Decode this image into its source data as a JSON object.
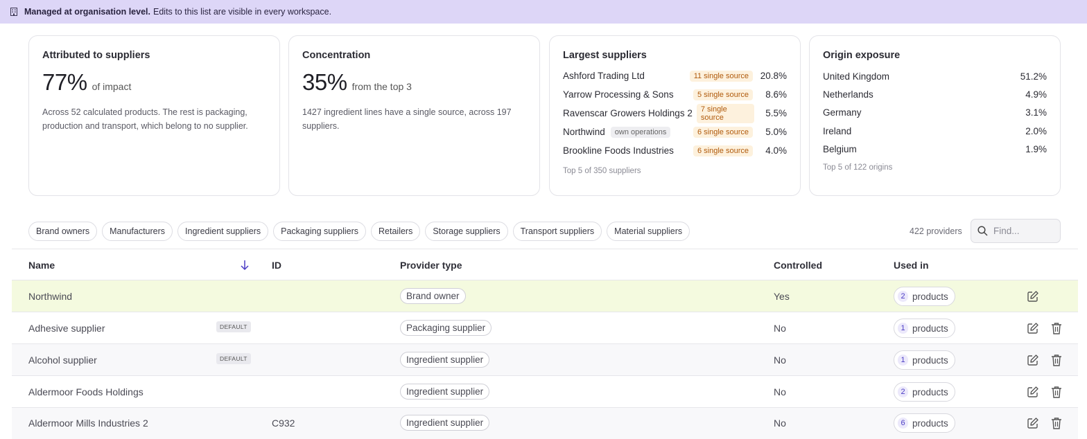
{
  "banner": {
    "bold": "Managed at organisation level.",
    "text": "Edits to this list are visible in every workspace."
  },
  "cards": {
    "attributed": {
      "title": "Attributed to suppliers",
      "value": "77%",
      "suffix": "of impact",
      "desc": "Across 52 calculated products. The rest is packaging, production and transport, which belong to no supplier."
    },
    "concentration": {
      "title": "Concentration",
      "value": "35%",
      "suffix": "from the top 3",
      "desc": "1427 ingredient lines have a single source, across 197 suppliers."
    },
    "largest": {
      "title": "Largest suppliers",
      "rows": [
        {
          "name": "Ashford Trading Ltd",
          "own": "",
          "single": "11 single source",
          "pct": "20.8%"
        },
        {
          "name": "Yarrow Processing & Sons",
          "own": "",
          "single": "5 single source",
          "pct": "8.6%"
        },
        {
          "name": "Ravenscar Growers Holdings 2",
          "own": "",
          "single": "7 single source",
          "pct": "5.5%"
        },
        {
          "name": "Northwind",
          "own": "own operations",
          "single": "6 single source",
          "pct": "5.0%"
        },
        {
          "name": "Brookline Foods Industries",
          "own": "",
          "single": "6 single source",
          "pct": "4.0%"
        }
      ],
      "footer": "Top 5 of 350 suppliers"
    },
    "origin": {
      "title": "Origin exposure",
      "rows": [
        {
          "name": "United Kingdom",
          "pct": "51.2%"
        },
        {
          "name": "Netherlands",
          "pct": "4.9%"
        },
        {
          "name": "Germany",
          "pct": "3.1%"
        },
        {
          "name": "Ireland",
          "pct": "2.0%"
        },
        {
          "name": "Belgium",
          "pct": "1.9%"
        }
      ],
      "footer": "Top 5 of 122 origins"
    }
  },
  "filters": [
    "Brand owners",
    "Manufacturers",
    "Ingredient suppliers",
    "Packaging suppliers",
    "Retailers",
    "Storage suppliers",
    "Transport suppliers",
    "Material suppliers"
  ],
  "count": "422 providers",
  "search": {
    "placeholder": "Find..."
  },
  "table": {
    "headers": {
      "name": "Name",
      "id": "ID",
      "type": "Provider type",
      "controlled": "Controlled",
      "used": "Used in"
    },
    "products_word": "products",
    "rows": [
      {
        "name": "Northwind",
        "badge": "",
        "id": "",
        "type": "Brand owner",
        "controlled": "Yes",
        "count": "2"
      },
      {
        "name": "Adhesive supplier",
        "badge": "DEFAULT",
        "id": "",
        "type": "Packaging supplier",
        "controlled": "No",
        "count": "1"
      },
      {
        "name": "Alcohol supplier",
        "badge": "DEFAULT",
        "id": "",
        "type": "Ingredient supplier",
        "controlled": "No",
        "count": "1"
      },
      {
        "name": "Aldermoor Foods Holdings",
        "badge": "",
        "id": "",
        "type": "Ingredient supplier",
        "controlled": "No",
        "count": "2"
      },
      {
        "name": "Aldermoor Mills Industries 2",
        "badge": "",
        "id": "C932",
        "type": "Ingredient supplier",
        "controlled": "No",
        "count": "6"
      }
    ]
  },
  "colors": {
    "banner": "#ddd6f7",
    "highlight_row": "#f4fadf",
    "accent": "#4a3bc4",
    "single_tag": "#b05a0c"
  }
}
